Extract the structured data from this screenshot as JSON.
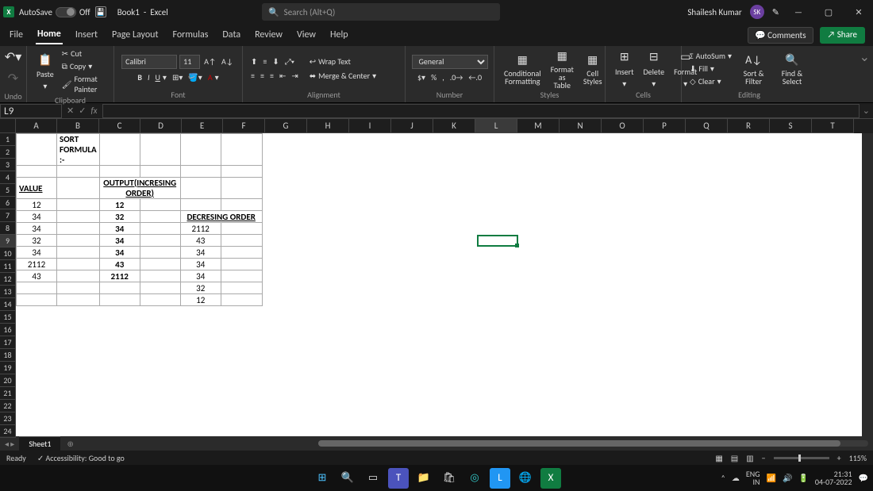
{
  "titlebar": {
    "autosave_label": "AutoSave",
    "autosave_state": "Off",
    "docname": "Book1",
    "appname": "Excel",
    "search_placeholder": "Search (Alt+Q)",
    "username": "Shailesh Kumar",
    "user_initials": "SK"
  },
  "menu": {
    "tabs": [
      "File",
      "Home",
      "Insert",
      "Page Layout",
      "Formulas",
      "Data",
      "Review",
      "View",
      "Help"
    ],
    "active": "Home",
    "comments": "Comments",
    "share": "Share"
  },
  "ribbon": {
    "undo": "Undo",
    "clipboard": {
      "paste": "Paste",
      "cut": "Cut",
      "copy": "Copy",
      "painter": "Format Painter",
      "label": "Clipboard"
    },
    "font": {
      "name": "Calibri",
      "size": "11",
      "label": "Font"
    },
    "alignment": {
      "wrap": "Wrap Text",
      "merge": "Merge & Center",
      "label": "Alignment"
    },
    "number": {
      "format": "General",
      "label": "Number"
    },
    "styles": {
      "cond": "Conditional Formatting",
      "table": "Format as Table",
      "cell": "Cell Styles",
      "label": "Styles"
    },
    "cells": {
      "insert": "Insert",
      "delete": "Delete",
      "format": "Format",
      "label": "Cells"
    },
    "editing": {
      "autosum": "AutoSum",
      "fill": "Fill",
      "clear": "Clear",
      "sort": "Sort & Filter",
      "find": "Find & Select",
      "label": "Editing"
    }
  },
  "nameBox": "L9",
  "columns": [
    "A",
    "B",
    "C",
    "D",
    "E",
    "F",
    "G",
    "H",
    "I",
    "J",
    "K",
    "L",
    "M",
    "N",
    "O",
    "P",
    "Q",
    "R",
    "S",
    "T"
  ],
  "rows": 24,
  "activeRow": 9,
  "activeCol": "L",
  "chart_data": {
    "type": "table",
    "title": "SORT FORMULA :-",
    "value_header": "VALUE",
    "output_header": "OUTPUT(INCRESING ORDER)",
    "decreasing_header": "DECRESING ORDER",
    "values": [
      12,
      34,
      34,
      32,
      34,
      2112,
      43
    ],
    "increasing": [
      12,
      32,
      34,
      34,
      34,
      43,
      2112
    ],
    "decreasing": [
      2112,
      43,
      34,
      34,
      34,
      32,
      12
    ]
  },
  "sheet": {
    "nav": "◂ ▸",
    "name": "Sheet1",
    "add": "⊕"
  },
  "status": {
    "ready": "Ready",
    "access": "Accessibility: Good to go",
    "zoom": "115%"
  },
  "taskbar": {
    "lang1": "ENG",
    "lang2": "IN",
    "time": "21:31",
    "date": "04-07-2022"
  }
}
